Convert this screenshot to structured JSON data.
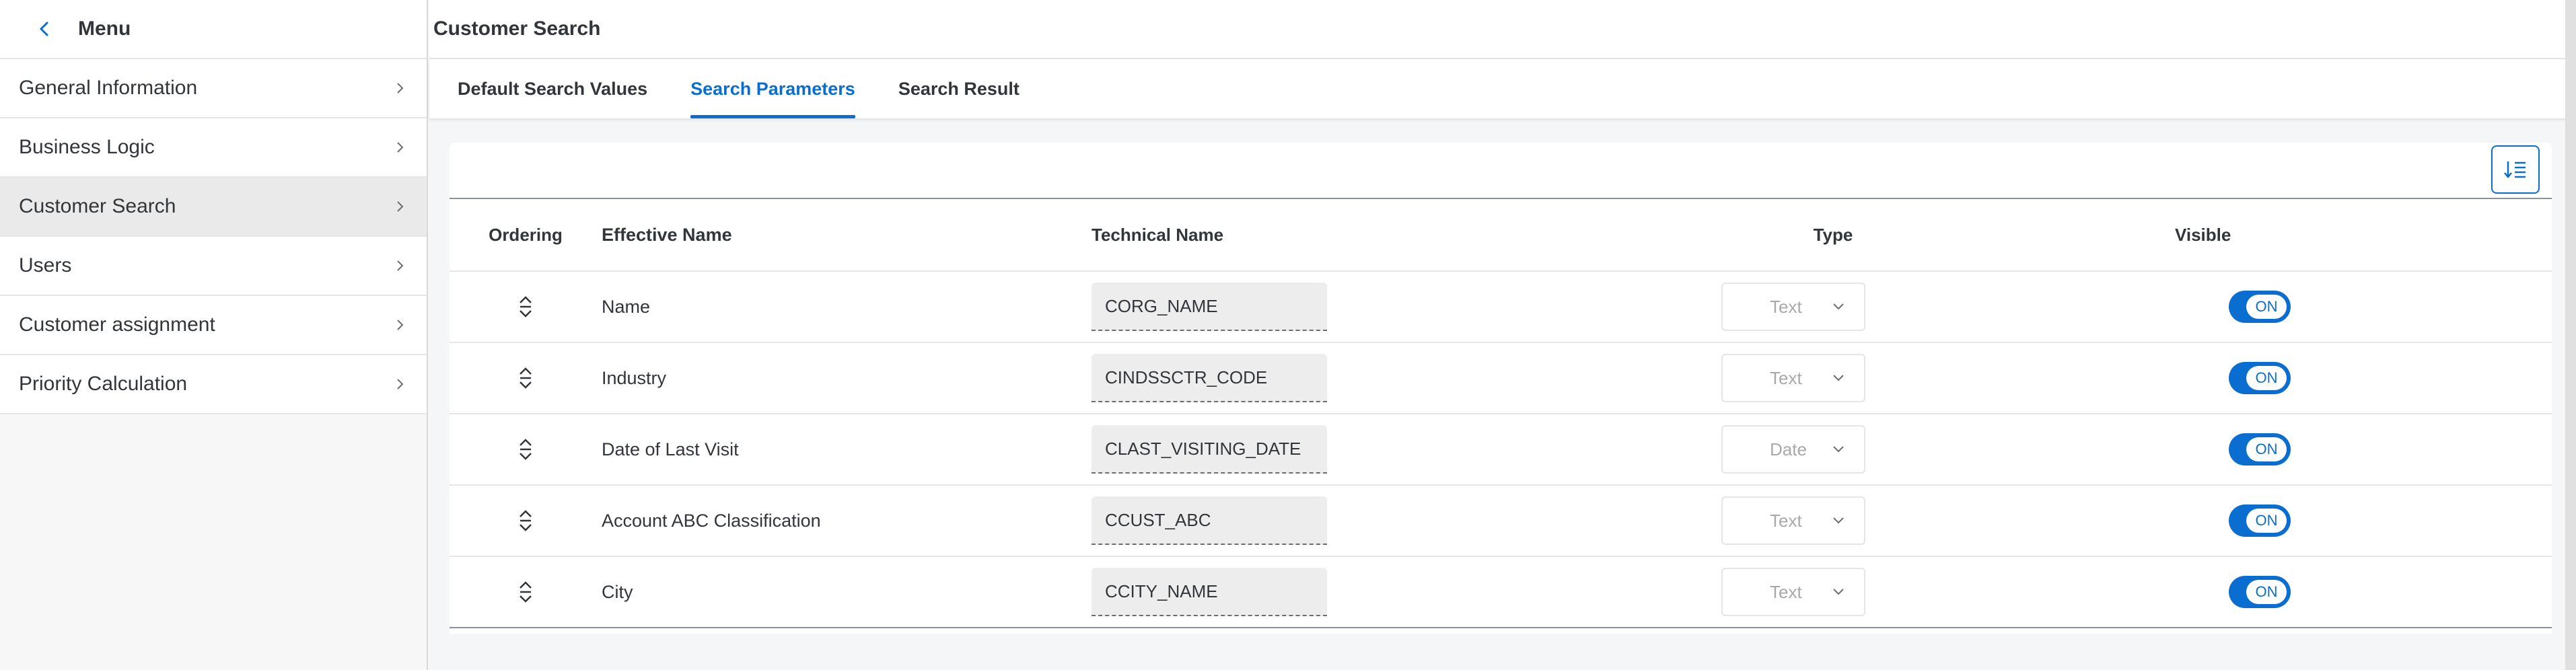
{
  "sidebar": {
    "title": "Menu",
    "items": [
      {
        "label": "General Information"
      },
      {
        "label": "Business Logic"
      },
      {
        "label": "Customer Search"
      },
      {
        "label": "Users"
      },
      {
        "label": "Customer assignment"
      },
      {
        "label": "Priority Calculation"
      }
    ],
    "active_index": 2
  },
  "main": {
    "title": "Customer Search",
    "tabs": [
      {
        "label": "Default Search Values"
      },
      {
        "label": "Search Parameters"
      },
      {
        "label": "Search Result"
      }
    ],
    "active_tab": 1,
    "table": {
      "headers": {
        "ordering": "Ordering",
        "effective_name": "Effective Name",
        "technical_name": "Technical Name",
        "type": "Type",
        "visible": "Visible"
      },
      "rows": [
        {
          "effective_name": "Name",
          "technical_name": "CORG_NAME",
          "type": "Text",
          "visible": "ON"
        },
        {
          "effective_name": "Industry",
          "technical_name": "CINDSSCTR_CODE",
          "type": "Text",
          "visible": "ON"
        },
        {
          "effective_name": "Date of Last Visit",
          "technical_name": "CLAST_VISITING_DATE",
          "type": "Date",
          "visible": "ON"
        },
        {
          "effective_name": "Account ABC Classification",
          "technical_name": "CCUST_ABC",
          "type": "Text",
          "visible": "ON"
        },
        {
          "effective_name": "City",
          "technical_name": "CCITY_NAME",
          "type": "Text",
          "visible": "ON"
        }
      ]
    }
  },
  "colors": {
    "accent": "#0a6ed1",
    "text": "#32363a",
    "background": "#f5f6f7"
  },
  "icons": {
    "back": "chevron-left-icon",
    "nav_item": "chevron-right-icon",
    "sort": "sort-ascending-icon",
    "ordering": "reorder-arrows-icon",
    "select": "chevron-down-icon"
  }
}
